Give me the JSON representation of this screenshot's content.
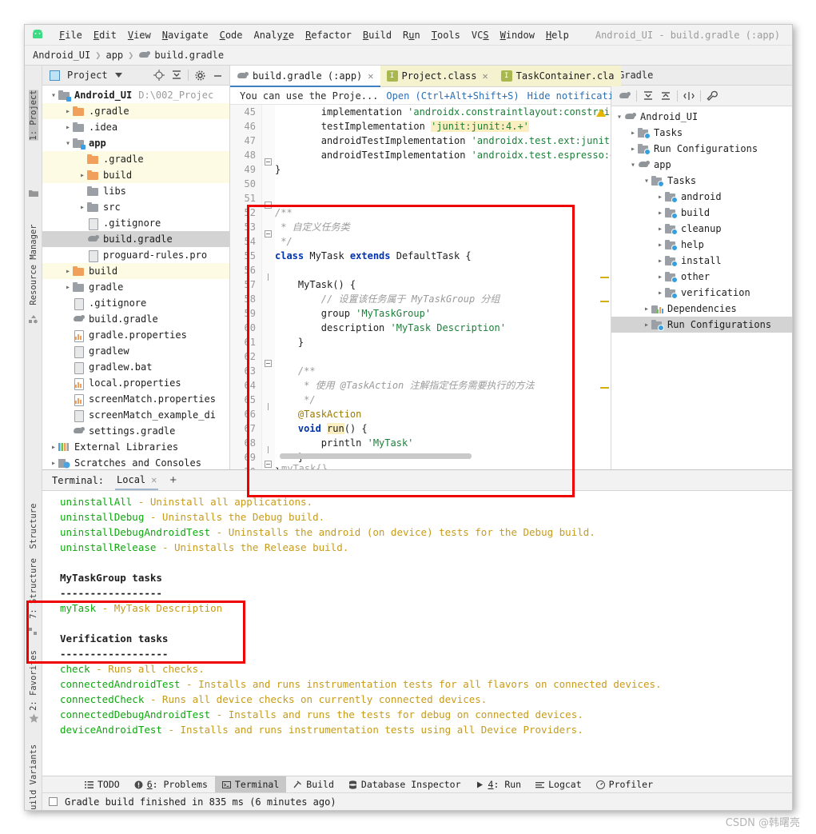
{
  "window": {
    "title": "Android_UI - build.gradle (:app)",
    "logo_icon": "android-robot-icon"
  },
  "menubar": {
    "items": [
      {
        "label": "File",
        "mnemonic": "F"
      },
      {
        "label": "Edit",
        "mnemonic": "E"
      },
      {
        "label": "View",
        "mnemonic": "V"
      },
      {
        "label": "Navigate",
        "mnemonic": "N"
      },
      {
        "label": "Code",
        "mnemonic": "C"
      },
      {
        "label": "Analyze",
        "mnemonic": "z"
      },
      {
        "label": "Refactor",
        "mnemonic": "R"
      },
      {
        "label": "Build",
        "mnemonic": "B"
      },
      {
        "label": "Run",
        "mnemonic": "u"
      },
      {
        "label": "Tools",
        "mnemonic": "T"
      },
      {
        "label": "VCS",
        "mnemonic": "S"
      },
      {
        "label": "Window",
        "mnemonic": "W"
      },
      {
        "label": "Help",
        "mnemonic": "H"
      }
    ]
  },
  "breadcrumb": {
    "items": [
      "Android_UI",
      "app",
      "build.gradle"
    ],
    "separator": "❯",
    "file_icon": "gradle-elephant-icon"
  },
  "left_rail": {
    "items": [
      {
        "label": "1: Project",
        "active": true,
        "icon": "project-folder-icon"
      },
      {
        "label": "Resource Manager",
        "active": false,
        "icon": "resource-manager-icon"
      },
      {
        "label": "Structure",
        "active": false,
        "icon": ""
      },
      {
        "label": "7: Structure",
        "active": false,
        "icon": "structure-icon"
      },
      {
        "label": "2: Favorites",
        "active": false,
        "icon": "star-icon"
      },
      {
        "label": "Build Variants",
        "active": false,
        "icon": "android-icon"
      }
    ]
  },
  "project_panel": {
    "title": "Project",
    "toolbar_icons": [
      "chevron-down-icon",
      "locate-target-icon",
      "collapse-all-icon",
      "settings-gear-icon",
      "hide-minus-icon"
    ],
    "tree": [
      {
        "depth": 0,
        "arrow": "v",
        "label": "Android_UI",
        "note": "D:\\002_Projec",
        "icon": "folder-grey-module",
        "bold": true,
        "hl": "none"
      },
      {
        "depth": 1,
        "arrow": ">",
        "label": ".gradle",
        "note": "",
        "icon": "folder-orange",
        "bold": false,
        "hl": "yellow"
      },
      {
        "depth": 1,
        "arrow": ">",
        "label": ".idea",
        "note": "",
        "icon": "folder-grey",
        "bold": false,
        "hl": "none"
      },
      {
        "depth": 1,
        "arrow": "v",
        "label": "app",
        "note": "",
        "icon": "folder-grey-module",
        "bold": true,
        "hl": "none"
      },
      {
        "depth": 2,
        "arrow": "",
        "label": ".gradle",
        "note": "",
        "icon": "folder-orange",
        "bold": false,
        "hl": "yellow"
      },
      {
        "depth": 2,
        "arrow": ">",
        "label": "build",
        "note": "",
        "icon": "folder-orange",
        "bold": false,
        "hl": "yellow"
      },
      {
        "depth": 2,
        "arrow": "",
        "label": "libs",
        "note": "",
        "icon": "folder-grey",
        "bold": false,
        "hl": "none"
      },
      {
        "depth": 2,
        "arrow": ">",
        "label": "src",
        "note": "",
        "icon": "folder-grey",
        "bold": false,
        "hl": "none"
      },
      {
        "depth": 2,
        "arrow": "",
        "label": ".gitignore",
        "note": "",
        "icon": "gitignore-file",
        "bold": false,
        "hl": "none"
      },
      {
        "depth": 2,
        "arrow": "",
        "label": "build.gradle",
        "note": "",
        "icon": "gradle-elephant-icon",
        "bold": false,
        "hl": "grey"
      },
      {
        "depth": 2,
        "arrow": "",
        "label": "proguard-rules.pro",
        "note": "",
        "icon": "text-file",
        "bold": false,
        "hl": "none"
      },
      {
        "depth": 1,
        "arrow": ">",
        "label": "build",
        "note": "",
        "icon": "folder-orange",
        "bold": false,
        "hl": "yellow"
      },
      {
        "depth": 1,
        "arrow": ">",
        "label": "gradle",
        "note": "",
        "icon": "folder-grey",
        "bold": false,
        "hl": "none"
      },
      {
        "depth": 1,
        "arrow": "",
        "label": ".gitignore",
        "note": "",
        "icon": "gitignore-file",
        "bold": false,
        "hl": "none"
      },
      {
        "depth": 1,
        "arrow": "",
        "label": "build.gradle",
        "note": "",
        "icon": "gradle-elephant-icon",
        "bold": false,
        "hl": "none"
      },
      {
        "depth": 1,
        "arrow": "",
        "label": "gradle.properties",
        "note": "",
        "icon": "properties-file",
        "bold": false,
        "hl": "none"
      },
      {
        "depth": 1,
        "arrow": "",
        "label": "gradlew",
        "note": "",
        "icon": "script-file",
        "bold": false,
        "hl": "none"
      },
      {
        "depth": 1,
        "arrow": "",
        "label": "gradlew.bat",
        "note": "",
        "icon": "text-file",
        "bold": false,
        "hl": "none"
      },
      {
        "depth": 1,
        "arrow": "",
        "label": "local.properties",
        "note": "",
        "icon": "properties-file",
        "bold": false,
        "hl": "none"
      },
      {
        "depth": 1,
        "arrow": "",
        "label": "screenMatch.properties",
        "note": "",
        "icon": "properties-file",
        "bold": false,
        "hl": "none"
      },
      {
        "depth": 1,
        "arrow": "",
        "label": "screenMatch_example_di",
        "note": "",
        "icon": "xml-file",
        "bold": false,
        "hl": "none"
      },
      {
        "depth": 1,
        "arrow": "",
        "label": "settings.gradle",
        "note": "",
        "icon": "gradle-elephant-icon",
        "bold": false,
        "hl": "none"
      },
      {
        "depth": 0,
        "arrow": ">",
        "label": "External Libraries",
        "note": "",
        "icon": "libraries-icon",
        "bold": false,
        "hl": "none"
      },
      {
        "depth": 0,
        "arrow": ">",
        "label": "Scratches and Consoles",
        "note": "",
        "icon": "scratches-icon",
        "bold": false,
        "hl": "none"
      }
    ]
  },
  "editor": {
    "tabs": [
      {
        "label": "build.gradle (:app)",
        "icon": "gradle-elephant-icon",
        "active": true,
        "closable": true,
        "style": "active"
      },
      {
        "label": "Project.class",
        "icon": "class-icon",
        "active": false,
        "closable": true,
        "style": "yellow"
      },
      {
        "label": "TaskContainer.cla",
        "icon": "class-icon",
        "active": false,
        "closable": false,
        "style": "yellow"
      }
    ],
    "tabs_overflow_icon": "chevron-down-icon",
    "notification": {
      "text": "You can use the Proje...",
      "open_link": "Open (Ctrl+Alt+Shift+S)",
      "hide_link": "Hide notification"
    },
    "first_line_number": 45,
    "lines": [
      {
        "n": 45,
        "segments": [
          {
            "t": "        implementation ",
            "c": "plain"
          },
          {
            "t": "'androidx.constraintlayout:constrain",
            "c": "str"
          }
        ]
      },
      {
        "n": 46,
        "segments": [
          {
            "t": "        testImplementation ",
            "c": "plain"
          },
          {
            "t": "'junit:junit:4.+'",
            "c": "str-hl"
          }
        ]
      },
      {
        "n": 47,
        "segments": [
          {
            "t": "        androidTestImplementation ",
            "c": "plain"
          },
          {
            "t": "'androidx.test.ext:junit:",
            "c": "str"
          }
        ]
      },
      {
        "n": 48,
        "segments": [
          {
            "t": "        androidTestImplementation ",
            "c": "plain"
          },
          {
            "t": "'androidx.test.espresso:e",
            "c": "str"
          }
        ]
      },
      {
        "n": 49,
        "segments": [
          {
            "t": "}",
            "c": "plain"
          }
        ]
      },
      {
        "n": 50,
        "segments": []
      },
      {
        "n": 51,
        "segments": []
      },
      {
        "n": 52,
        "segments": [
          {
            "t": "/**",
            "c": "cmt"
          }
        ]
      },
      {
        "n": 53,
        "segments": [
          {
            "t": " * 自定义任务类",
            "c": "cmt"
          }
        ]
      },
      {
        "n": 54,
        "segments": [
          {
            "t": " */",
            "c": "cmt"
          }
        ]
      },
      {
        "n": 55,
        "segments": [
          {
            "t": "class",
            "c": "kw"
          },
          {
            "t": " MyTask ",
            "c": "plain"
          },
          {
            "t": "extends",
            "c": "kw"
          },
          {
            "t": " DefaultTask {",
            "c": "plain"
          }
        ]
      },
      {
        "n": 56,
        "segments": []
      },
      {
        "n": 57,
        "segments": [
          {
            "t": "    MyTask() {",
            "c": "plain"
          }
        ]
      },
      {
        "n": 58,
        "segments": [
          {
            "t": "        // 设置该任务属于 MyTaskGroup 分组",
            "c": "cmt"
          }
        ]
      },
      {
        "n": 59,
        "segments": [
          {
            "t": "        group ",
            "c": "plain"
          },
          {
            "t": "'MyTaskGroup'",
            "c": "str"
          }
        ]
      },
      {
        "n": 60,
        "segments": [
          {
            "t": "        description ",
            "c": "plain"
          },
          {
            "t": "'MyTask Description'",
            "c": "str"
          }
        ]
      },
      {
        "n": 61,
        "segments": [
          {
            "t": "    }",
            "c": "plain"
          }
        ]
      },
      {
        "n": 62,
        "segments": []
      },
      {
        "n": 63,
        "segments": [
          {
            "t": "    /**",
            "c": "cmt"
          }
        ]
      },
      {
        "n": 64,
        "segments": [
          {
            "t": "     * 使用 @TaskAction 注解指定任务需要执行的方法",
            "c": "cmt"
          }
        ]
      },
      {
        "n": 65,
        "segments": [
          {
            "t": "     */",
            "c": "cmt"
          }
        ]
      },
      {
        "n": 66,
        "segments": [
          {
            "t": "    @TaskAction",
            "c": "anno"
          }
        ]
      },
      {
        "n": 67,
        "segments": [
          {
            "t": "    void ",
            "c": "kw"
          },
          {
            "t": "run",
            "c": "hl"
          },
          {
            "t": "() {",
            "c": "plain"
          }
        ]
      },
      {
        "n": 68,
        "segments": [
          {
            "t": "        println ",
            "c": "plain"
          },
          {
            "t": "'MyTask'",
            "c": "str"
          }
        ]
      },
      {
        "n": 69,
        "segments": [
          {
            "t": "    }",
            "c": "plain"
          }
        ]
      },
      {
        "n": 70,
        "segments": [
          {
            "t": "}",
            "c": "plain"
          }
        ]
      }
    ],
    "ghost_text": "myTask{}"
  },
  "gradle_panel": {
    "title": "Gradle",
    "toolbar_icons": [
      "gradle-elephant-icon",
      "expand-all-icon",
      "collapse-all-icon",
      "toggle-offline-icon",
      "wrench-icon"
    ],
    "tree": [
      {
        "depth": 0,
        "arrow": "v",
        "label": "Android_UI",
        "icon": "gradle-elephant-icon",
        "selected": false
      },
      {
        "depth": 1,
        "arrow": ">",
        "label": "Tasks",
        "icon": "gear-folder-icon",
        "selected": false
      },
      {
        "depth": 1,
        "arrow": ">",
        "label": "Run Configurations",
        "icon": "gear-folder-icon",
        "selected": false
      },
      {
        "depth": 1,
        "arrow": "v",
        "label": "app",
        "icon": "gradle-elephant-icon",
        "selected": false
      },
      {
        "depth": 2,
        "arrow": "v",
        "label": "Tasks",
        "icon": "gear-folder-icon",
        "selected": false
      },
      {
        "depth": 3,
        "arrow": ">",
        "label": "android",
        "icon": "gear-folder-icon",
        "selected": false
      },
      {
        "depth": 3,
        "arrow": ">",
        "label": "build",
        "icon": "gear-folder-icon",
        "selected": false
      },
      {
        "depth": 3,
        "arrow": ">",
        "label": "cleanup",
        "icon": "gear-folder-icon",
        "selected": false
      },
      {
        "depth": 3,
        "arrow": ">",
        "label": "help",
        "icon": "gear-folder-icon",
        "selected": false
      },
      {
        "depth": 3,
        "arrow": ">",
        "label": "install",
        "icon": "gear-folder-icon",
        "selected": false
      },
      {
        "depth": 3,
        "arrow": ">",
        "label": "other",
        "icon": "gear-folder-icon",
        "selected": false
      },
      {
        "depth": 3,
        "arrow": ">",
        "label": "verification",
        "icon": "gear-folder-icon",
        "selected": false
      },
      {
        "depth": 2,
        "arrow": ">",
        "label": "Dependencies",
        "icon": "dependencies-icon",
        "selected": false
      },
      {
        "depth": 2,
        "arrow": ">",
        "label": "Run Configurations",
        "icon": "gear-folder-icon",
        "selected": true
      }
    ]
  },
  "terminal": {
    "label": "Terminal:",
    "tab": "Local",
    "close_icon": "close-icon",
    "add_icon": "plus-icon",
    "lines": [
      {
        "style": "task",
        "task": "uninstallAll",
        "desc": " - Uninstall all applications."
      },
      {
        "style": "task",
        "task": "uninstallDebug",
        "desc": " - Uninstalls the Debug build."
      },
      {
        "style": "task",
        "task": "uninstallDebugAndroidTest",
        "desc": " - Uninstalls the android (on device) tests for the Debug build."
      },
      {
        "style": "task",
        "task": "uninstallRelease",
        "desc": " - Uninstalls the Release build."
      },
      {
        "style": "blank",
        "task": "",
        "desc": ""
      },
      {
        "style": "head",
        "task": "MyTaskGroup tasks",
        "desc": ""
      },
      {
        "style": "rule",
        "task": "-----------------",
        "desc": ""
      },
      {
        "style": "task",
        "task": "myTask",
        "desc": " - MyTask Description"
      },
      {
        "style": "blank",
        "task": "",
        "desc": ""
      },
      {
        "style": "head",
        "task": "Verification tasks",
        "desc": ""
      },
      {
        "style": "rule",
        "task": "------------------",
        "desc": ""
      },
      {
        "style": "task",
        "task": "check",
        "desc": " - Runs all checks."
      },
      {
        "style": "task",
        "task": "connectedAndroidTest",
        "desc": " - Installs and runs instrumentation tests for all flavors on connected devices."
      },
      {
        "style": "task",
        "task": "connectedCheck",
        "desc": " - Runs all device checks on currently connected devices."
      },
      {
        "style": "task",
        "task": "connectedDebugAndroidTest",
        "desc": " - Installs and runs the tests for debug on connected devices."
      },
      {
        "style": "task",
        "task": "deviceAndroidTest",
        "desc": " - Installs and runs instrumentation tests using all Device Providers."
      }
    ]
  },
  "tool_buttons": [
    {
      "label": "TODO",
      "icon": "todo-list-icon",
      "active": false
    },
    {
      "label": "6: Problems",
      "icon": "problems-icon",
      "active": false,
      "mnemonic": "6"
    },
    {
      "label": "Terminal",
      "icon": "terminal-icon",
      "active": true
    },
    {
      "label": "Build",
      "icon": "build-hammer-icon",
      "active": false
    },
    {
      "label": "Database Inspector",
      "icon": "database-icon",
      "active": false
    },
    {
      "label": "4: Run",
      "icon": "run-play-icon",
      "active": false,
      "mnemonic": "4"
    },
    {
      "label": "Logcat",
      "icon": "logcat-icon",
      "active": false
    },
    {
      "label": "Profiler",
      "icon": "profiler-gauge-icon",
      "active": false
    }
  ],
  "statusbar": {
    "icon": "event-log-icon",
    "message": "Gradle build finished in 835 ms (6 minutes ago)"
  },
  "watermark": "CSDN @韩曙亮",
  "colors": {
    "accent_blue": "#3e7fc1",
    "link_blue": "#2a6fb5",
    "highlight_red": "#ee0000",
    "terminal_green": "#0fa80f",
    "terminal_gold": "#c79b1b",
    "keyword_blue": "#0033b3",
    "string_green": "#1a7f37",
    "comment_grey": "#9b9b9b",
    "annotation_gold": "#9c7a00",
    "folder_orange": "#f0a05a",
    "tab_yellow": "#f5f2d0"
  }
}
